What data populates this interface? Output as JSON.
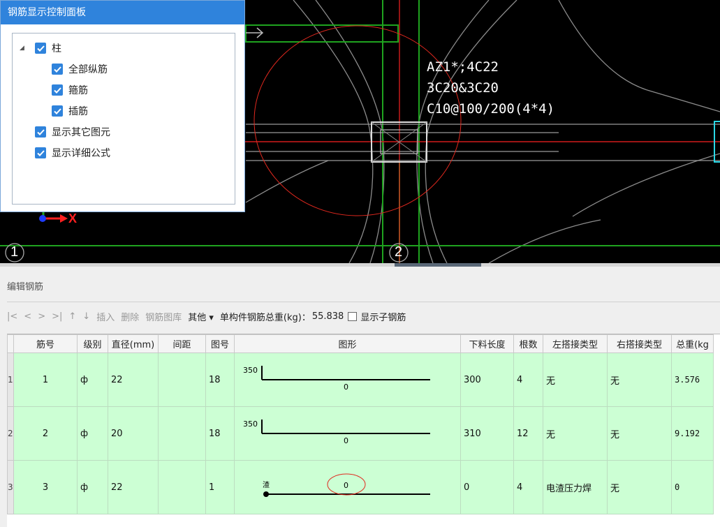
{
  "panel": {
    "title": "钢筋显示控制面板",
    "tree": {
      "root": {
        "label": "柱",
        "checked": true,
        "expanded": true
      },
      "children": [
        {
          "label": "全部纵筋",
          "checked": true
        },
        {
          "label": "箍筋",
          "checked": true
        },
        {
          "label": "插筋",
          "checked": true
        }
      ],
      "extra": [
        {
          "label": "显示其它图元",
          "checked": true
        },
        {
          "label": "显示详细公式",
          "checked": true
        }
      ]
    }
  },
  "viewport": {
    "annotation": [
      "AZ1*;4C22",
      "3C20&3C20",
      "C10@100/200(4*4)"
    ],
    "axis_x_label": "X",
    "grid_labels": [
      "1",
      "2"
    ]
  },
  "editor": {
    "title": "编辑钢筋",
    "toolbar": {
      "nav": [
        "|<",
        "<",
        ">",
        ">|"
      ],
      "move_up": "↑",
      "move_down": "↓",
      "insert": "插入",
      "delete": "删除",
      "library": "钢筋图库",
      "other": "其他 ▾",
      "weight_label": "单构件钢筋总重(kg)：",
      "weight_value": "55.838",
      "show_sub_label": "显示子钢筋",
      "show_sub_checked": false
    },
    "columns": [
      "筋号",
      "级别",
      "直径(mm)",
      "间距",
      "图号",
      "图形",
      "下料长度",
      "根数",
      "左搭接类型",
      "右搭接类型",
      "总重(kg"
    ],
    "rows": [
      {
        "row": "1",
        "no": "1",
        "grade": "ф",
        "dia": "22",
        "spacing": "",
        "fig": "18",
        "shape_left": "350",
        "shape_mid": "0",
        "length": "300",
        "count": "4",
        "left_lap": "无",
        "right_lap": "无",
        "weight": "3.576"
      },
      {
        "row": "2",
        "no": "2",
        "grade": "ф",
        "dia": "20",
        "spacing": "",
        "fig": "18",
        "shape_left": "350",
        "shape_mid": "0",
        "length": "310",
        "count": "12",
        "left_lap": "无",
        "right_lap": "无",
        "weight": "9.192"
      },
      {
        "row": "3",
        "no": "3",
        "grade": "ф",
        "dia": "22",
        "spacing": "",
        "fig": "1",
        "shape_left": "渣",
        "shape_mid": "0",
        "length": "0",
        "count": "4",
        "left_lap": "电渣压力焊",
        "right_lap": "无",
        "weight": "0"
      }
    ]
  },
  "colors": {
    "title_blue": "#2f83dc",
    "row_green": "#ccffd4",
    "grid_green": "#1fa31f",
    "axis_red": "#ff2020",
    "cursor_red": "#e0281e"
  }
}
